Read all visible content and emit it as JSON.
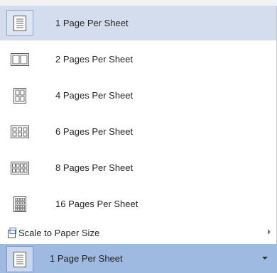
{
  "menu": {
    "items": [
      {
        "label": "1 Page Per Sheet",
        "icon": "page-1-per-sheet-icon",
        "selected": true
      },
      {
        "label": "2 Pages Per Sheet",
        "icon": "pages-2-per-sheet-icon",
        "selected": false
      },
      {
        "label": "4 Pages Per Sheet",
        "icon": "pages-4-per-sheet-icon",
        "selected": false
      },
      {
        "label": "6 Pages Per Sheet",
        "icon": "pages-6-per-sheet-icon",
        "selected": false
      },
      {
        "label": "8 Pages Per Sheet",
        "icon": "pages-8-per-sheet-icon",
        "selected": false
      },
      {
        "label": "16 Pages Per Sheet",
        "icon": "pages-16-per-sheet-icon",
        "selected": false
      }
    ],
    "scale": {
      "label": "Scale to Paper Size",
      "icon": "scale-to-paper-icon"
    }
  },
  "dropdown": {
    "selected_label": "1 Page Per Sheet"
  },
  "colors": {
    "selected_bg": "#d4ddee",
    "bar_bg": "#9fbae0",
    "accent_border": "#8fa6c9"
  }
}
